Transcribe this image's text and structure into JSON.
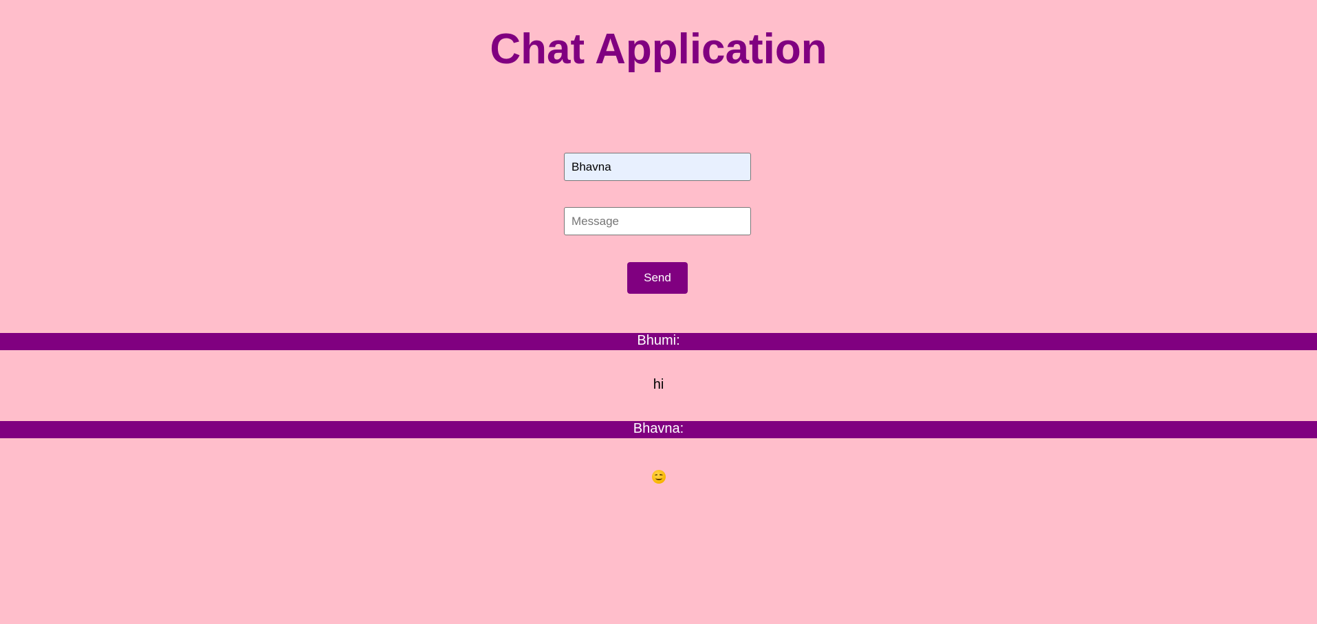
{
  "title": "Chat Application",
  "form": {
    "name_value": "Bhavna",
    "message_placeholder": "Message",
    "message_value": "",
    "send_label": "Send"
  },
  "messages": [
    {
      "sender": "Bhumi:",
      "text": "hi"
    },
    {
      "sender": "Bhavna:",
      "text": "😊",
      "icon": "smiling-face-emoji"
    }
  ],
  "colors": {
    "background": "#ffbecb",
    "accent": "#800080",
    "name_field_bg": "#e8f0fe"
  }
}
